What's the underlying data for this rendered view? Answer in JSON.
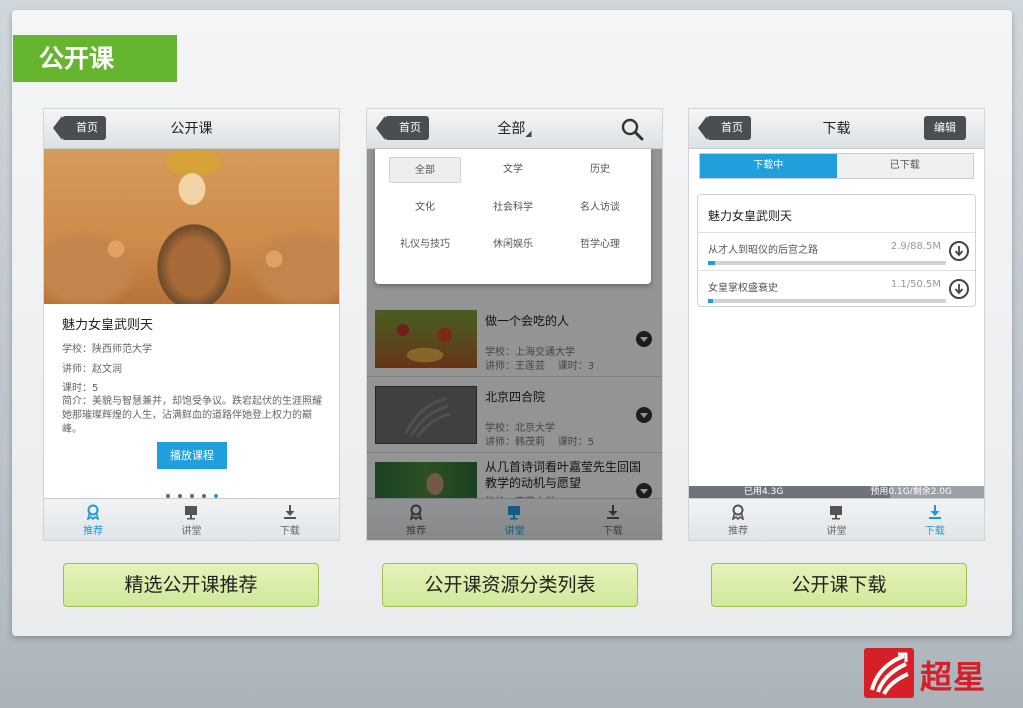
{
  "slide": {
    "title": "公开课"
  },
  "phone1": {
    "nav": {
      "back": "首页",
      "title": "公开课"
    },
    "course": {
      "name": "魅力女皇武则天",
      "school": "学校：陕西师范大学",
      "teacher": "讲师：赵文润",
      "hours": "课时：5",
      "intro": "简介：美貌与智慧兼并，却饱受争议。跌宕起伏的生涯照耀她那璀璨辉煌的人生，沾满鲜血的道路伴她登上权力的巅峰。",
      "play": "播放课程"
    },
    "carousel": {
      "count": 5,
      "active": 4
    },
    "tabs": [
      "推荐",
      "讲堂",
      "下载"
    ]
  },
  "phone2": {
    "nav": {
      "back": "首页",
      "title": "全部",
      "caret": "◢"
    },
    "categories": [
      "全部",
      "文学",
      "历史",
      "文化",
      "社会科学",
      "名人访谈",
      "礼仪与技巧",
      "休闲娱乐",
      "哲学心理"
    ],
    "list": [
      {
        "title": "做一个会吃的人",
        "school": "学校：上海交通大学",
        "teacher": "讲师：王莲芸",
        "hours": "课时：3"
      },
      {
        "title": "北京四合院",
        "school": "学校：北京大学",
        "teacher": "讲师：韩茂莉",
        "hours": "课时：5"
      },
      {
        "title": "从几首诗词看叶嘉莹先生回国教学的动机与愿望",
        "school": "学校：南开大学"
      }
    ],
    "tabs": [
      "推荐",
      "讲堂",
      "下载"
    ]
  },
  "phone3": {
    "nav": {
      "back": "首页",
      "title": "下载",
      "edit": "编辑"
    },
    "segments": [
      "下载中",
      "已下载"
    ],
    "course": "魅力女皇武则天",
    "downloads": [
      {
        "name": "从才人到昭仪的后宫之路",
        "size": "2.9/88.5M",
        "progress": 0.03
      },
      {
        "name": "女皇掌权盛衰史",
        "size": "1.1/50.5M",
        "progress": 0.02
      }
    ],
    "storage": {
      "used": "已用4.3G",
      "total": "预用0.1G/剩余2.0G",
      "used_fraction": 0.68
    },
    "tabs": [
      "推荐",
      "讲堂",
      "下载"
    ]
  },
  "captions": [
    "精选公开课推荐",
    "公开课资源分类列表",
    "公开课下载"
  ],
  "logo": {
    "text": "超星"
  },
  "colors": {
    "accent": "#1f9fdb",
    "title_green": "#66b52e",
    "logo_red": "#d61f26"
  }
}
